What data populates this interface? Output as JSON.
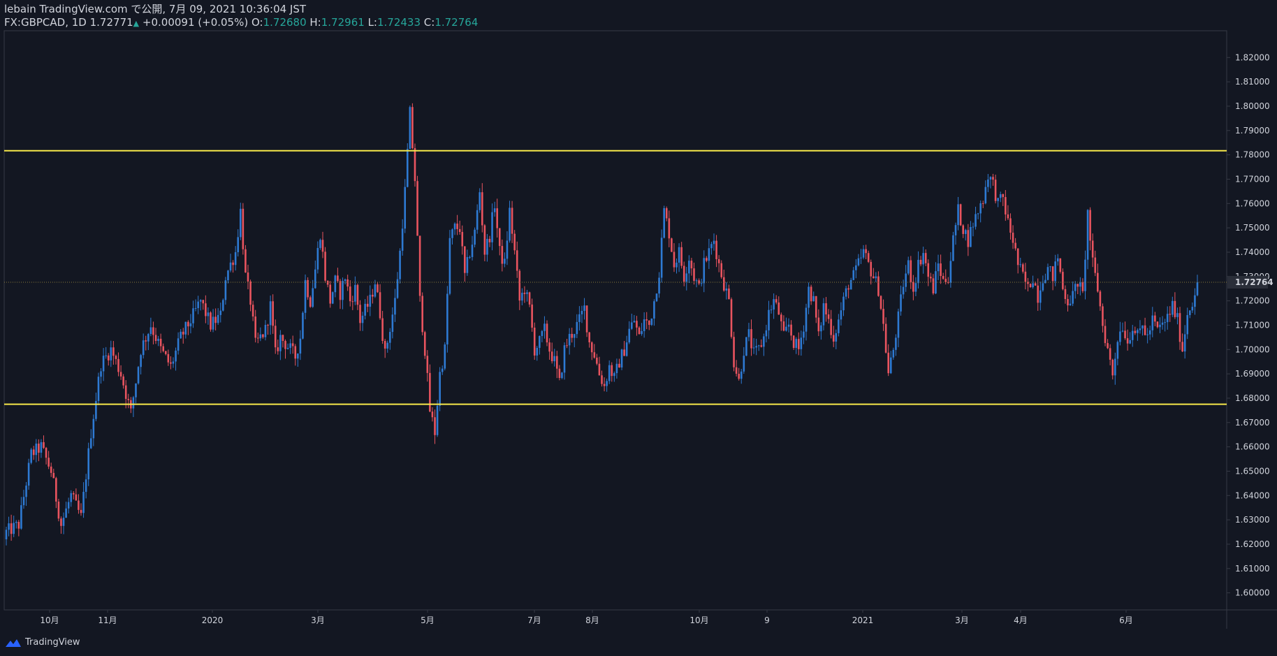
{
  "header": {
    "published": "lebain TradingView.com で公開, 7月 09, 2021 10:36:04 JST",
    "symbol": "FX:GBPCAD, 1D",
    "last": "1.72771",
    "change_arrow": "▲",
    "change": "+0.00091 (+0.05%)",
    "o_label": "O:",
    "o_value": "1.72680",
    "h_label": "H:",
    "h_value": "1.72961",
    "l_label": "L:",
    "l_value": "1.72433",
    "c_label": "C:",
    "c_value": "1.72764"
  },
  "footer": {
    "brand": "TradingView",
    "logo_icon": "tradingview-logo-icon"
  },
  "colors": {
    "background": "#131722",
    "up": "#2e7ad3",
    "down": "#e9545f",
    "level_line": "#f7e94a",
    "price_line": "#8a7a3a",
    "grid": "#363a45",
    "text": "#d1d4dc",
    "accent": "#26a69a"
  },
  "chart_data": {
    "type": "candlestick",
    "symbol": "FX:GBPCAD",
    "interval": "1D",
    "ylim": [
      1.593,
      1.831
    ],
    "y_ticks": [
      "1.60000",
      "1.61000",
      "1.62000",
      "1.63000",
      "1.64000",
      "1.65000",
      "1.66000",
      "1.67000",
      "1.68000",
      "1.69000",
      "1.70000",
      "1.71000",
      "1.72000",
      "1.73000",
      "1.74000",
      "1.75000",
      "1.76000",
      "1.77000",
      "1.78000",
      "1.79000",
      "1.80000",
      "1.81000",
      "1.82000"
    ],
    "x_ticks": [
      "10月",
      "11月",
      "2020",
      "3月",
      "5月",
      "7月",
      "8月",
      "10月",
      "9",
      "2021",
      "3月",
      "4月",
      "6月"
    ],
    "current_price_label": "1.72764",
    "current_price": 1.72764,
    "horizontal_lines": [
      1.7817,
      1.6775
    ],
    "close_path": [
      [
        0,
        1.625
      ],
      [
        5,
        1.628
      ],
      [
        10,
        1.657
      ],
      [
        14,
        1.66
      ],
      [
        18,
        1.65
      ],
      [
        22,
        1.628
      ],
      [
        26,
        1.64
      ],
      [
        30,
        1.631
      ],
      [
        34,
        1.666
      ],
      [
        38,
        1.694
      ],
      [
        42,
        1.7
      ],
      [
        46,
        1.69
      ],
      [
        50,
        1.674
      ],
      [
        54,
        1.7
      ],
      [
        58,
        1.71
      ],
      [
        62,
        1.7
      ],
      [
        66,
        1.693
      ],
      [
        70,
        1.705
      ],
      [
        74,
        1.712
      ],
      [
        78,
        1.72
      ],
      [
        82,
        1.71
      ],
      [
        86,
        1.714
      ],
      [
        88,
        1.73
      ],
      [
        92,
        1.74
      ],
      [
        94,
        1.757
      ],
      [
        96,
        1.73
      ],
      [
        98,
        1.72
      ],
      [
        100,
        1.702
      ],
      [
        104,
        1.708
      ],
      [
        106,
        1.718
      ],
      [
        108,
        1.698
      ],
      [
        110,
        1.705
      ],
      [
        114,
        1.7
      ],
      [
        116,
        1.697
      ],
      [
        118,
        1.705
      ],
      [
        120,
        1.728
      ],
      [
        122,
        1.72
      ],
      [
        124,
        1.733
      ],
      [
        126,
        1.748
      ],
      [
        128,
        1.73
      ],
      [
        130,
        1.72
      ],
      [
        132,
        1.728
      ],
      [
        134,
        1.723
      ],
      [
        136,
        1.73
      ],
      [
        138,
        1.72
      ],
      [
        140,
        1.725
      ],
      [
        142,
        1.712
      ],
      [
        146,
        1.72
      ],
      [
        148,
        1.728
      ],
      [
        150,
        1.715
      ],
      [
        152,
        1.698
      ],
      [
        156,
        1.72
      ],
      [
        158,
        1.74
      ],
      [
        160,
        1.765
      ],
      [
        162,
        1.797
      ],
      [
        164,
        1.77
      ],
      [
        166,
        1.72
      ],
      [
        168,
        1.7
      ],
      [
        170,
        1.675
      ],
      [
        172,
        1.666
      ],
      [
        174,
        1.69
      ],
      [
        176,
        1.7
      ],
      [
        178,
        1.745
      ],
      [
        180,
        1.75
      ],
      [
        182,
        1.75
      ],
      [
        184,
        1.73
      ],
      [
        186,
        1.74
      ],
      [
        188,
        1.748
      ],
      [
        190,
        1.765
      ],
      [
        192,
        1.74
      ],
      [
        194,
        1.747
      ],
      [
        196,
        1.76
      ],
      [
        198,
        1.74
      ],
      [
        200,
        1.735
      ],
      [
        202,
        1.757
      ],
      [
        204,
        1.74
      ],
      [
        206,
        1.72
      ],
      [
        208,
        1.725
      ],
      [
        210,
        1.717
      ],
      [
        212,
        1.7
      ],
      [
        214,
        1.703
      ],
      [
        216,
        1.708
      ],
      [
        218,
        1.7
      ],
      [
        220,
        1.695
      ],
      [
        222,
        1.686
      ],
      [
        224,
        1.7
      ],
      [
        226,
        1.705
      ],
      [
        228,
        1.708
      ],
      [
        230,
        1.712
      ],
      [
        232,
        1.717
      ],
      [
        234,
        1.703
      ],
      [
        236,
        1.698
      ],
      [
        238,
        1.69
      ],
      [
        240,
        1.685
      ],
      [
        242,
        1.693
      ],
      [
        244,
        1.688
      ],
      [
        246,
        1.695
      ],
      [
        248,
        1.7
      ],
      [
        250,
        1.708
      ],
      [
        252,
        1.712
      ],
      [
        254,
        1.705
      ],
      [
        256,
        1.712
      ],
      [
        258,
        1.71
      ],
      [
        260,
        1.72
      ],
      [
        262,
        1.732
      ],
      [
        264,
        1.757
      ],
      [
        266,
        1.748
      ],
      [
        268,
        1.735
      ],
      [
        270,
        1.74
      ],
      [
        272,
        1.73
      ],
      [
        274,
        1.738
      ],
      [
        276,
        1.73
      ],
      [
        278,
        1.725
      ],
      [
        280,
        1.735
      ],
      [
        282,
        1.74
      ],
      [
        284,
        1.745
      ],
      [
        286,
        1.735
      ],
      [
        288,
        1.727
      ],
      [
        290,
        1.72
      ],
      [
        292,
        1.695
      ],
      [
        294,
        1.687
      ],
      [
        296,
        1.7
      ],
      [
        298,
        1.706
      ],
      [
        300,
        1.698
      ],
      [
        302,
        1.7
      ],
      [
        304,
        1.705
      ],
      [
        306,
        1.715
      ],
      [
        308,
        1.72
      ],
      [
        310,
        1.715
      ],
      [
        312,
        1.705
      ],
      [
        314,
        1.71
      ],
      [
        316,
        1.703
      ],
      [
        318,
        1.7
      ],
      [
        320,
        1.71
      ],
      [
        322,
        1.725
      ],
      [
        324,
        1.72
      ],
      [
        326,
        1.705
      ],
      [
        328,
        1.718
      ],
      [
        330,
        1.712
      ],
      [
        332,
        1.705
      ],
      [
        334,
        1.712
      ],
      [
        336,
        1.72
      ],
      [
        338,
        1.727
      ],
      [
        340,
        1.73
      ],
      [
        342,
        1.735
      ],
      [
        344,
        1.74
      ],
      [
        346,
        1.735
      ],
      [
        348,
        1.73
      ],
      [
        350,
        1.725
      ],
      [
        352,
        1.71
      ],
      [
        354,
        1.69
      ],
      [
        356,
        1.7
      ],
      [
        358,
        1.713
      ],
      [
        360,
        1.727
      ],
      [
        362,
        1.735
      ],
      [
        364,
        1.725
      ],
      [
        366,
        1.735
      ],
      [
        368,
        1.74
      ],
      [
        370,
        1.73
      ],
      [
        372,
        1.725
      ],
      [
        374,
        1.735
      ],
      [
        376,
        1.728
      ],
      [
        378,
        1.73
      ],
      [
        380,
        1.745
      ],
      [
        382,
        1.757
      ],
      [
        384,
        1.75
      ],
      [
        386,
        1.745
      ],
      [
        388,
        1.752
      ],
      [
        390,
        1.757
      ],
      [
        392,
        1.762
      ],
      [
        394,
        1.772
      ],
      [
        396,
        1.768
      ],
      [
        398,
        1.76
      ],
      [
        400,
        1.762
      ],
      [
        402,
        1.752
      ],
      [
        404,
        1.745
      ],
      [
        406,
        1.735
      ],
      [
        408,
        1.73
      ],
      [
        410,
        1.725
      ],
      [
        412,
        1.73
      ],
      [
        414,
        1.722
      ],
      [
        416,
        1.73
      ],
      [
        418,
        1.733
      ],
      [
        420,
        1.73
      ],
      [
        422,
        1.738
      ],
      [
        424,
        1.725
      ],
      [
        426,
        1.72
      ],
      [
        428,
        1.722
      ],
      [
        430,
        1.728
      ],
      [
        432,
        1.722
      ],
      [
        434,
        1.756
      ],
      [
        436,
        1.735
      ],
      [
        438,
        1.725
      ],
      [
        440,
        1.71
      ],
      [
        442,
        1.7
      ],
      [
        444,
        1.69
      ],
      [
        446,
        1.705
      ],
      [
        448,
        1.71
      ],
      [
        450,
        1.703
      ],
      [
        452,
        1.71
      ],
      [
        454,
        1.705
      ],
      [
        456,
        1.71
      ],
      [
        458,
        1.705
      ],
      [
        460,
        1.712
      ],
      [
        462,
        1.708
      ],
      [
        464,
        1.71
      ],
      [
        466,
        1.713
      ],
      [
        468,
        1.718
      ],
      [
        470,
        1.712
      ],
      [
        472,
        1.7
      ],
      [
        474,
        1.715
      ],
      [
        476,
        1.72
      ],
      [
        478,
        1.7275
      ]
    ]
  }
}
